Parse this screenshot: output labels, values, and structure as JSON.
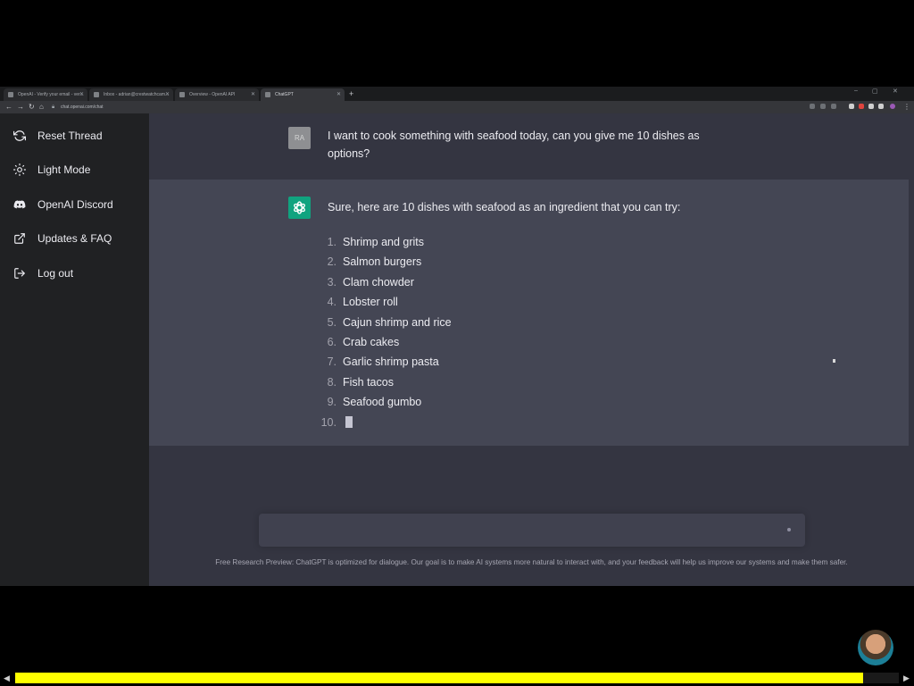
{
  "browser": {
    "tabs": [
      {
        "title": "OpenAI - Verify your email - ver..."
      },
      {
        "title": "Inbox - adrian@crestwatchcam..."
      },
      {
        "title": "Overview - OpenAI API"
      },
      {
        "title": "ChatGPT"
      }
    ],
    "new_tab": "+",
    "url": "chat.openai.com/chat"
  },
  "sidebar": {
    "items": [
      {
        "label": "Reset Thread",
        "icon": "refresh-icon"
      },
      {
        "label": "Light Mode",
        "icon": "sun-icon"
      },
      {
        "label": "OpenAI Discord",
        "icon": "discord-icon"
      },
      {
        "label": "Updates & FAQ",
        "icon": "external-link-icon"
      },
      {
        "label": "Log out",
        "icon": "logout-icon"
      }
    ]
  },
  "conversation": {
    "user_initials": "RA",
    "user_message": "I want to cook something with seafood today, can you give me 10 dishes as options?",
    "assistant_intro": "Sure, here are 10 dishes with seafood as an ingredient that you can try:",
    "dishes": [
      {
        "num": "1.",
        "name": "Shrimp and grits"
      },
      {
        "num": "2.",
        "name": "Salmon burgers"
      },
      {
        "num": "3.",
        "name": "Clam chowder"
      },
      {
        "num": "4.",
        "name": "Lobster roll"
      },
      {
        "num": "5.",
        "name": "Cajun shrimp and rice"
      },
      {
        "num": "6.",
        "name": "Crab cakes"
      },
      {
        "num": "7.",
        "name": "Garlic shrimp pasta"
      },
      {
        "num": "8.",
        "name": "Fish tacos"
      },
      {
        "num": "9.",
        "name": "Seafood gumbo"
      },
      {
        "num": "10.",
        "name": ""
      }
    ]
  },
  "footer": {
    "disclaimer": "Free Research Preview: ChatGPT is optimized for dialogue. Our goal is to make AI systems more natural to interact with, and your feedback will help us improve our systems and make them safer."
  },
  "video": {
    "progress": 0.96
  },
  "colors": {
    "accent": "#10a37f",
    "progress": "#ffff00",
    "sidebar_bg": "#202123",
    "main_bg": "#343541",
    "assistant_bg": "#444654"
  }
}
